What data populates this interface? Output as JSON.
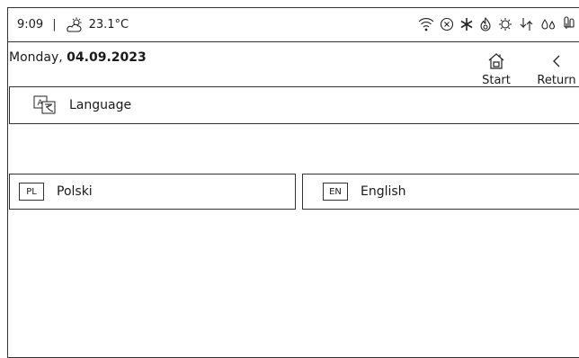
{
  "status": {
    "time": "9:09",
    "temperature": "23.1°C",
    "icons": [
      "weather-partly-sunny-icon",
      "wifi-icon",
      "cancel-circle-icon",
      "snowflake-icon",
      "flame-icon",
      "heat-pump-icon",
      "ground-source-icon",
      "water-drops-icon",
      "thermometer-icon"
    ]
  },
  "header": {
    "weekday": "Monday,",
    "date": "04.09.2023",
    "start_label": "Start",
    "return_label": "Return"
  },
  "section": {
    "title": "Language",
    "icon": "language-translate-icon"
  },
  "languages": [
    {
      "code": "PL",
      "name": "Polski"
    },
    {
      "code": "EN",
      "name": "English"
    }
  ]
}
